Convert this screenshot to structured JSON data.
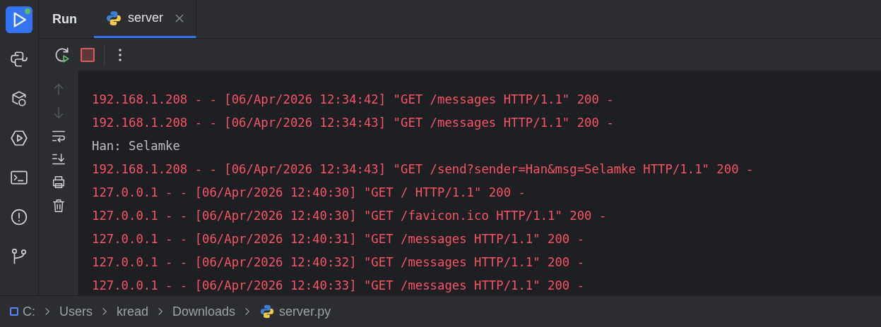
{
  "tool_strip": [
    {
      "kind": "run",
      "selected": true
    },
    {
      "kind": "python",
      "selected": false
    },
    {
      "kind": "packages",
      "selected": false
    },
    {
      "kind": "services",
      "selected": false
    },
    {
      "kind": "terminal",
      "selected": false
    },
    {
      "kind": "problems",
      "selected": false
    },
    {
      "kind": "git",
      "selected": false
    }
  ],
  "tool_window": {
    "title": "Run"
  },
  "tabs": [
    {
      "label": "server",
      "selected": true
    }
  ],
  "console_actions": [
    {
      "kind": "up",
      "disabled": true
    },
    {
      "kind": "down",
      "disabled": true
    },
    {
      "kind": "wrap",
      "disabled": false
    },
    {
      "kind": "scroll-end",
      "disabled": false
    },
    {
      "kind": "print",
      "disabled": false
    },
    {
      "kind": "clear",
      "disabled": false
    }
  ],
  "console_lines": [
    {
      "text": "192.168.1.208 - - [06/Apr/2026 12:34:42] \"GET /messages HTTP/1.1\" 200 -",
      "kind": "stderr"
    },
    {
      "text": "192.168.1.208 - - [06/Apr/2026 12:34:43] \"GET /messages HTTP/1.1\" 200 -",
      "kind": "stderr"
    },
    {
      "text": "Han: Selamke",
      "kind": "stdout"
    },
    {
      "text": "192.168.1.208 - - [06/Apr/2026 12:34:43] \"GET /send?sender=Han&msg=Selamke HTTP/1.1\" 200 -",
      "kind": "stderr"
    },
    {
      "text": "127.0.0.1 - - [06/Apr/2026 12:40:30] \"GET / HTTP/1.1\" 200 -",
      "kind": "stderr"
    },
    {
      "text": "127.0.0.1 - - [06/Apr/2026 12:40:30] \"GET /favicon.ico HTTP/1.1\" 200 -",
      "kind": "stderr"
    },
    {
      "text": "127.0.0.1 - - [06/Apr/2026 12:40:31] \"GET /messages HTTP/1.1\" 200 -",
      "kind": "stderr"
    },
    {
      "text": "127.0.0.1 - - [06/Apr/2026 12:40:32] \"GET /messages HTTP/1.1\" 200 -",
      "kind": "stderr"
    },
    {
      "text": "127.0.0.1 - - [06/Apr/2026 12:40:33] \"GET /messages HTTP/1.1\" 200 -",
      "kind": "stderr"
    }
  ],
  "breadcrumbs": [
    {
      "label": "C:",
      "kind": "drive"
    },
    {
      "label": "Users",
      "kind": "folder"
    },
    {
      "label": "kread",
      "kind": "folder"
    },
    {
      "label": "Downloads",
      "kind": "folder"
    },
    {
      "label": "server.py",
      "kind": "python"
    }
  ]
}
